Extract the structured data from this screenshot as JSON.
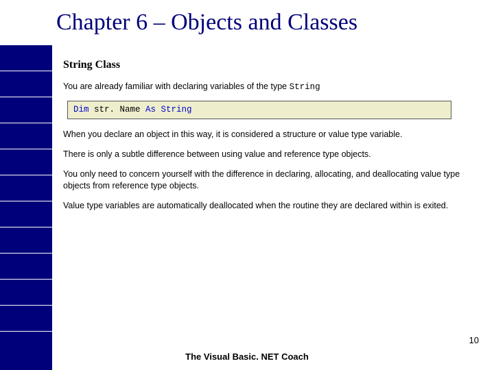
{
  "title": "Chapter 6 – Objects and Classes",
  "subheading": "String Class",
  "intro_prefix": "You are already familiar with declaring variables of the type ",
  "intro_code": "String",
  "code": {
    "kw1": "Dim",
    "var": " str. Name ",
    "kw2": "As String"
  },
  "paras": [
    "When you declare an object in this way, it is considered a structure or value type variable.",
    "There is only a subtle difference between using value and reference type objects.",
    "You only need to concern yourself with the difference in declaring, allocating, and deallocating value type objects from reference type objects.",
    "Value type variables are automatically deallocated when the routine they are declared within is exited."
  ],
  "footer": "The Visual Basic. NET Coach",
  "page_number": "10"
}
